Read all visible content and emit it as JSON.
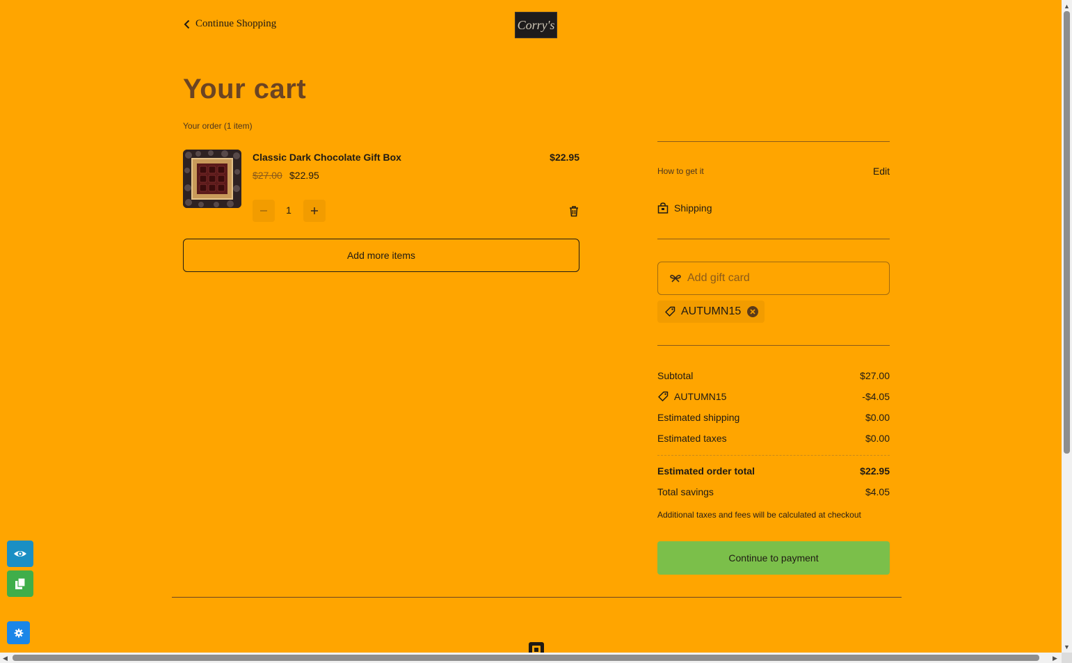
{
  "header": {
    "continue_shopping": "Continue Shopping",
    "logo_text": "Corry's"
  },
  "cart": {
    "title": "Your cart",
    "order_count": "Your order (1 item)",
    "items": [
      {
        "name": "Classic Dark Chocolate Gift Box",
        "line_total": "$22.95",
        "original_price": "$27.00",
        "sale_price": "$22.95",
        "quantity": "1"
      }
    ],
    "add_more_label": "Add more items"
  },
  "fulfillment": {
    "label": "How to get it",
    "edit_label": "Edit",
    "method": "Shipping"
  },
  "gift_card": {
    "placeholder": "Add gift card"
  },
  "coupon": {
    "code": "AUTUMN15"
  },
  "summary": {
    "subtotal_label": "Subtotal",
    "subtotal_value": "$27.00",
    "discount_label": "AUTUMN15",
    "discount_value": "-$4.05",
    "shipping_label": "Estimated shipping",
    "shipping_value": "$0.00",
    "taxes_label": "Estimated taxes",
    "taxes_value": "$0.00",
    "total_label": "Estimated order total",
    "total_value": "$22.95",
    "savings_label": "Total savings",
    "savings_value": "$4.05",
    "note": "Additional taxes and fees will be calculated at checkout",
    "pay_label": "Continue to payment"
  },
  "colors": {
    "background": "#FFA500",
    "title": "#6b4423",
    "pay_button": "#7bbf4a"
  },
  "floating_buttons": [
    "eye-icon",
    "copy-icon",
    "gear-icon"
  ]
}
